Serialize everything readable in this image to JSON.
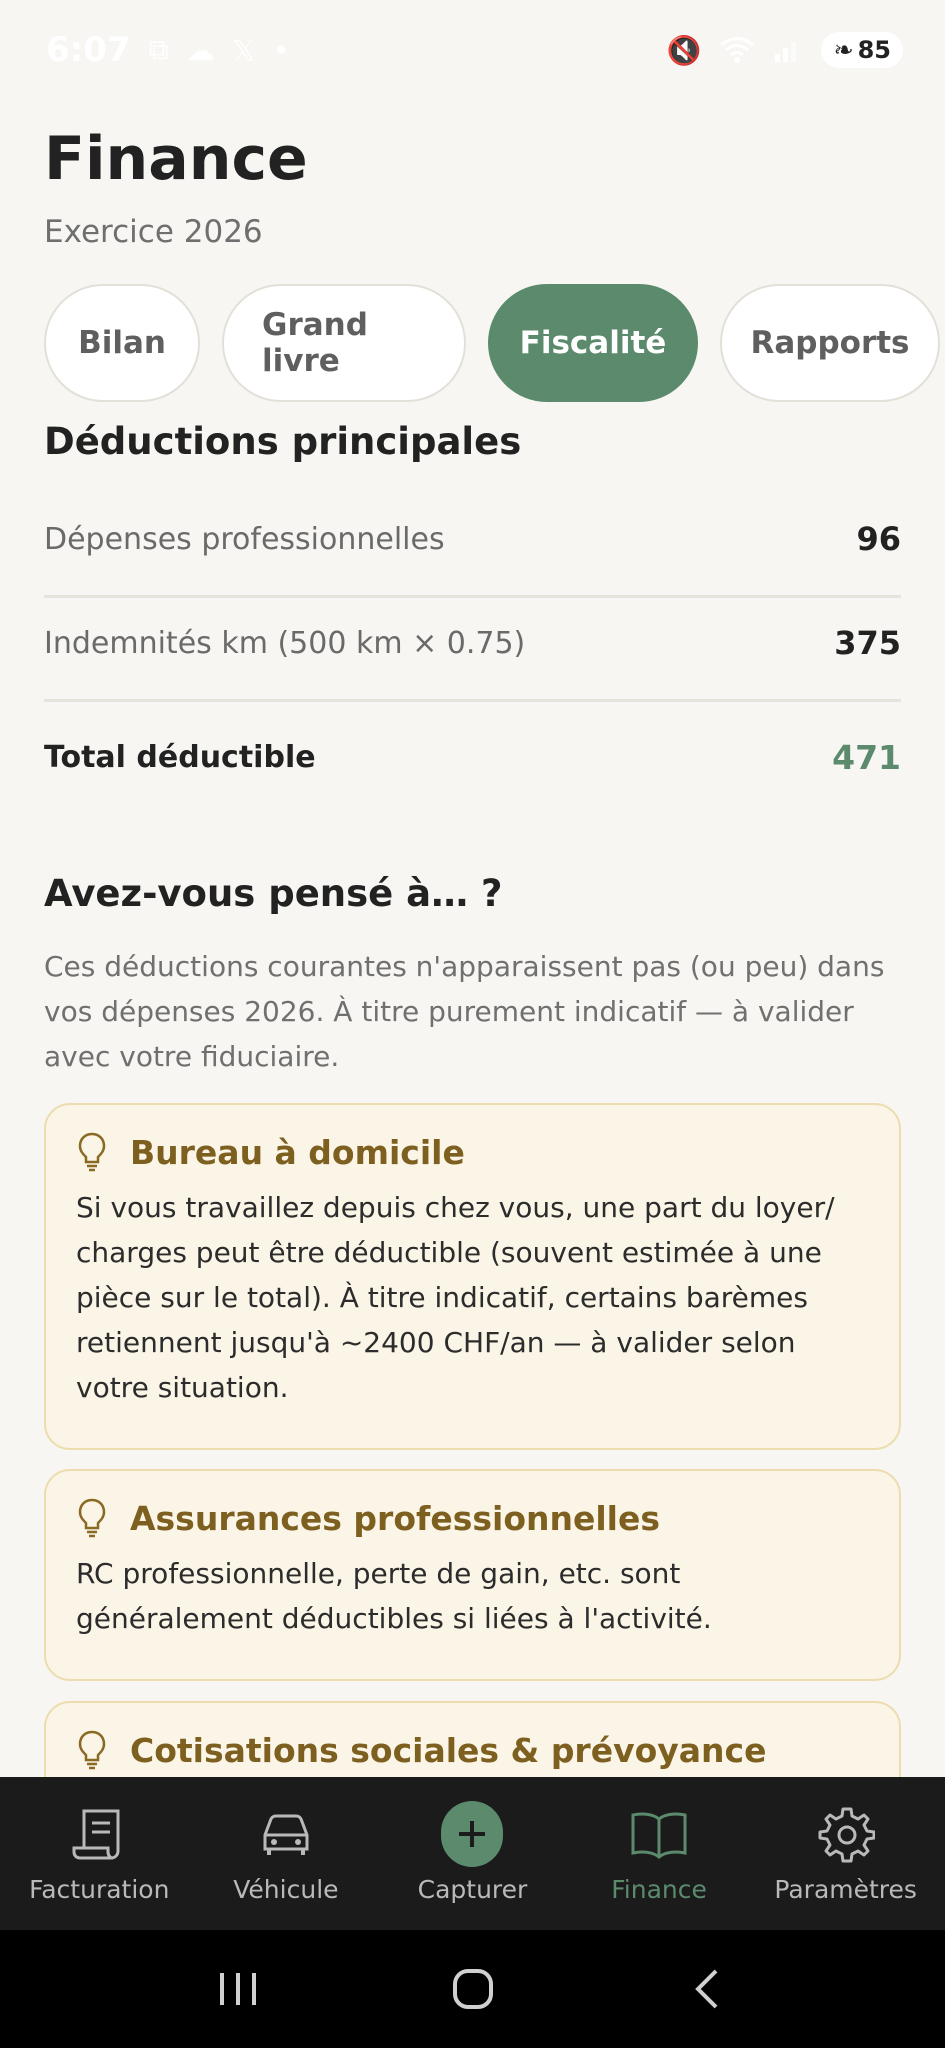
{
  "status_bar": {
    "time": "6:07",
    "battery": "85"
  },
  "header": {
    "title": "Finance",
    "subtitle": "Exercice 2026"
  },
  "tabs": [
    {
      "label": "Bilan",
      "active": false
    },
    {
      "label": "Grand livre",
      "active": false
    },
    {
      "label": "Fiscalité",
      "active": true
    },
    {
      "label": "Rapports",
      "active": false
    }
  ],
  "deductions": {
    "title": "Déductions principales",
    "rows": [
      {
        "label": "Dépenses professionnelles",
        "value": "96"
      },
      {
        "label": "Indemnités km (500 km × 0.75)",
        "value": "375"
      }
    ],
    "total": {
      "label": "Total déductible",
      "value": "471"
    }
  },
  "suggestions": {
    "title": "Avez-vous pensé à… ?",
    "intro": "Ces déductions courantes n'apparaissent pas (ou peu) dans vos dépenses 2026. À titre purement indicatif — à valider avec votre fiduciaire.",
    "cards": [
      {
        "title": "Bureau à domicile",
        "body": "Si vous travaillez depuis chez vous, une part du loyer/ charges peut être déductible (souvent estimée à une pièce sur le total). À titre indicatif, certains barèmes retiennent jusqu'à ~2400 CHF/an — à valider selon votre situation."
      },
      {
        "title": "Assurances professionnelles",
        "body": "RC professionnelle, perte de gain, etc. sont généralement déductibles si liées à l'activité."
      },
      {
        "title": "Cotisations sociales & prévoyance",
        "body": ""
      }
    ]
  },
  "bottom_nav": [
    {
      "label": "Facturation",
      "icon": "invoice-icon",
      "active": false
    },
    {
      "label": "Véhicule",
      "icon": "car-icon",
      "active": false
    },
    {
      "label": "Capturer",
      "icon": "plus-icon",
      "active": false
    },
    {
      "label": "Finance",
      "icon": "book-icon",
      "active": true
    },
    {
      "label": "Paramètres",
      "icon": "gear-icon",
      "active": false
    }
  ],
  "colors": {
    "accent": "#5b8a6c",
    "background": "#f7f6f2",
    "card_bg": "#fbf5e7",
    "card_title": "#7d5f1f"
  }
}
